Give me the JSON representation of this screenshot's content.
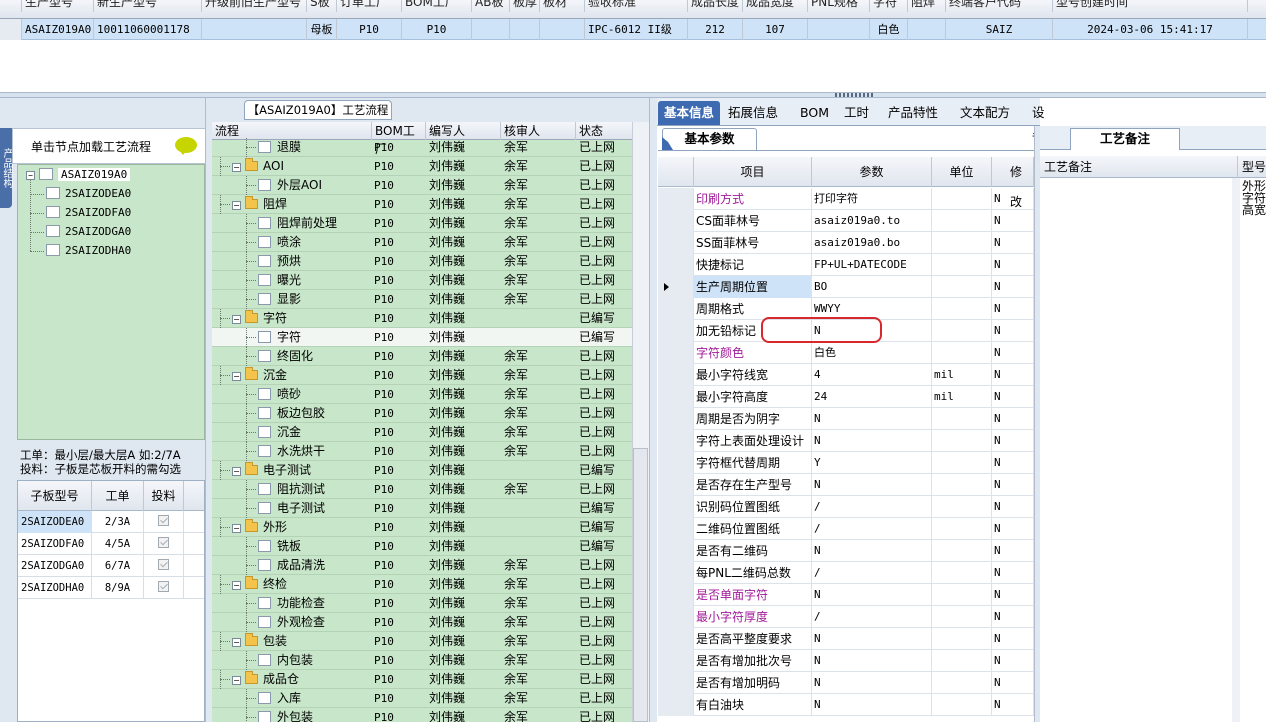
{
  "top_grid": {
    "headers": [
      "生产型号",
      "新生产型号",
      "升级前旧生产型号",
      "S板",
      "订单工厂",
      "BOM工厂",
      "AB板",
      "板厚",
      "板材",
      "验收标准",
      "成品长度",
      "成品宽度",
      "PNL规格",
      "字符",
      "阻焊",
      "终端客户代码",
      "型号创建时间"
    ],
    "row": [
      "ASAIZ019A0",
      "10011060001178",
      "",
      "母板",
      "P10",
      "P10",
      "",
      "",
      "",
      "IPC-6012 II级",
      "212",
      "107",
      "",
      "白色",
      "",
      "SAIZ",
      "2024-03-06 15:41:17"
    ]
  },
  "left_panel": {
    "vertical_tab": "产品结构",
    "hint": "单击节点加载工艺流程",
    "tree_root": "ASAIZ019A0",
    "tree_children": [
      "2SAIZODEA0",
      "2SAIZODFA0",
      "2SAIZODGA0",
      "2SAIZODHA0"
    ],
    "info_line1": "工单：最小层/最大层A 如:2/7A",
    "info_line2": "投料：子板是芯板开料的需勾选",
    "sub_headers": [
      "子板型号",
      "工单",
      "投料"
    ],
    "sub_rows": [
      {
        "model": "2SAIZODEA0",
        "order": "2/3A"
      },
      {
        "model": "2SAIZODFA0",
        "order": "4/5A"
      },
      {
        "model": "2SAIZODGA0",
        "order": "6/7A"
      },
      {
        "model": "2SAIZODHA0",
        "order": "8/9A"
      }
    ]
  },
  "process": {
    "title": "【ASAIZ019A0】工艺流程",
    "headers": [
      "流程",
      "BOM工厂",
      "编写人",
      "核审人",
      "状态"
    ],
    "rows": [
      {
        "name": "退膜",
        "type": "leaf",
        "factory": "P10",
        "writer": "刘伟巍",
        "reviewer": "余军",
        "status": "已上网"
      },
      {
        "name": "AOI",
        "type": "folder",
        "factory": "P10",
        "writer": "刘伟巍",
        "reviewer": "余军",
        "status": "已上网"
      },
      {
        "name": "外层AOI",
        "type": "leaf",
        "factory": "P10",
        "writer": "刘伟巍",
        "reviewer": "余军",
        "status": "已上网"
      },
      {
        "name": "阻焊",
        "type": "folder",
        "factory": "P10",
        "writer": "刘伟巍",
        "reviewer": "余军",
        "status": "已上网"
      },
      {
        "name": "阻焊前处理",
        "type": "leaf",
        "factory": "P10",
        "writer": "刘伟巍",
        "reviewer": "余军",
        "status": "已上网"
      },
      {
        "name": "喷涂",
        "type": "leaf",
        "factory": "P10",
        "writer": "刘伟巍",
        "reviewer": "余军",
        "status": "已上网"
      },
      {
        "name": "预烘",
        "type": "leaf",
        "factory": "P10",
        "writer": "刘伟巍",
        "reviewer": "余军",
        "status": "已上网"
      },
      {
        "name": "曝光",
        "type": "leaf",
        "factory": "P10",
        "writer": "刘伟巍",
        "reviewer": "余军",
        "status": "已上网"
      },
      {
        "name": "显影",
        "type": "leaf",
        "factory": "P10",
        "writer": "刘伟巍",
        "reviewer": "余军",
        "status": "已上网"
      },
      {
        "name": "字符",
        "type": "folder",
        "factory": "P10",
        "writer": "刘伟巍",
        "reviewer": "",
        "status": "已编写"
      },
      {
        "name": "字符",
        "type": "leaf",
        "factory": "P10",
        "writer": "刘伟巍",
        "reviewer": "",
        "status": "已编写"
      },
      {
        "name": "终固化",
        "type": "leaf",
        "factory": "P10",
        "writer": "刘伟巍",
        "reviewer": "余军",
        "status": "已上网"
      },
      {
        "name": "沉金",
        "type": "folder",
        "factory": "P10",
        "writer": "刘伟巍",
        "reviewer": "余军",
        "status": "已上网"
      },
      {
        "name": "喷砂",
        "type": "leaf",
        "factory": "P10",
        "writer": "刘伟巍",
        "reviewer": "余军",
        "status": "已上网"
      },
      {
        "name": "板边包胶",
        "type": "leaf",
        "factory": "P10",
        "writer": "刘伟巍",
        "reviewer": "余军",
        "status": "已上网"
      },
      {
        "name": "沉金",
        "type": "leaf",
        "factory": "P10",
        "writer": "刘伟巍",
        "reviewer": "余军",
        "status": "已上网"
      },
      {
        "name": "水洗烘干",
        "type": "leaf",
        "factory": "P10",
        "writer": "刘伟巍",
        "reviewer": "余军",
        "status": "已上网"
      },
      {
        "name": "电子测试",
        "type": "folder",
        "factory": "P10",
        "writer": "刘伟巍",
        "reviewer": "",
        "status": "已编写"
      },
      {
        "name": "阻抗测试",
        "type": "leaf",
        "factory": "P10",
        "writer": "刘伟巍",
        "reviewer": "余军",
        "status": "已上网"
      },
      {
        "name": "电子测试",
        "type": "leaf",
        "factory": "P10",
        "writer": "刘伟巍",
        "reviewer": "",
        "status": "已编写"
      },
      {
        "name": "外形",
        "type": "folder",
        "factory": "P10",
        "writer": "刘伟巍",
        "reviewer": "",
        "status": "已编写"
      },
      {
        "name": "铣板",
        "type": "leaf",
        "factory": "P10",
        "writer": "刘伟巍",
        "reviewer": "",
        "status": "已编写"
      },
      {
        "name": "成品清洗",
        "type": "leaf",
        "factory": "P10",
        "writer": "刘伟巍",
        "reviewer": "余军",
        "status": "已上网"
      },
      {
        "name": "终检",
        "type": "folder",
        "factory": "P10",
        "writer": "刘伟巍",
        "reviewer": "余军",
        "status": "已上网"
      },
      {
        "name": "功能检查",
        "type": "leaf",
        "factory": "P10",
        "writer": "刘伟巍",
        "reviewer": "余军",
        "status": "已上网"
      },
      {
        "name": "外观检查",
        "type": "leaf",
        "factory": "P10",
        "writer": "刘伟巍",
        "reviewer": "余军",
        "status": "已上网"
      },
      {
        "name": "包装",
        "type": "folder",
        "factory": "P10",
        "writer": "刘伟巍",
        "reviewer": "余军",
        "status": "已上网"
      },
      {
        "name": "内包装",
        "type": "leaf",
        "factory": "P10",
        "writer": "刘伟巍",
        "reviewer": "余军",
        "status": "已上网"
      },
      {
        "name": "成品仓",
        "type": "folder",
        "factory": "P10",
        "writer": "刘伟巍",
        "reviewer": "余军",
        "status": "已上网"
      },
      {
        "name": "入库",
        "type": "leaf",
        "factory": "P10",
        "writer": "刘伟巍",
        "reviewer": "余军",
        "status": "已上网"
      },
      {
        "name": "外包装",
        "type": "leaf",
        "factory": "P10",
        "writer": "刘伟巍",
        "reviewer": "余军",
        "status": "已上网"
      }
    ]
  },
  "right_tabs": [
    "基本信息",
    "拓展信息",
    "BOM",
    "工时",
    "产品特性",
    "文本配方",
    "设备配方"
  ],
  "basic_params": {
    "subtab": "基本参数",
    "headers": [
      "项目",
      "参数",
      "单位",
      "修改"
    ],
    "rows": [
      {
        "item": "印刷方式",
        "value": "打印字符",
        "unit": "",
        "mod": "N",
        "magenta": true
      },
      {
        "item": "CS面菲林号",
        "value": "asaiz019a0.to",
        "unit": "",
        "mod": "N"
      },
      {
        "item": "SS面菲林号",
        "value": "asaiz019a0.bo",
        "unit": "",
        "mod": "N"
      },
      {
        "item": "快捷标记",
        "value": "FP+UL+DATECODE",
        "unit": "",
        "mod": "N"
      },
      {
        "item": "生产周期位置",
        "value": "BO",
        "unit": "",
        "mod": "N",
        "current": true
      },
      {
        "item": "周期格式",
        "value": "WWYY",
        "unit": "",
        "mod": "N"
      },
      {
        "item": "加无铅标记",
        "value": "N",
        "unit": "",
        "mod": "N"
      },
      {
        "item": "字符颜色",
        "value": "白色",
        "unit": "",
        "mod": "N",
        "magenta": true
      },
      {
        "item": "最小字符线宽",
        "value": "4",
        "unit": "mil",
        "mod": "N"
      },
      {
        "item": "最小字符高度",
        "value": "24",
        "unit": "mil",
        "mod": "N"
      },
      {
        "item": "周期是否为阴字",
        "value": "N",
        "unit": "",
        "mod": "N"
      },
      {
        "item": "字符上表面处理设计",
        "value": "N",
        "unit": "",
        "mod": "N"
      },
      {
        "item": "字符框代替周期",
        "value": "Y",
        "unit": "",
        "mod": "N"
      },
      {
        "item": "是否存在生产型号",
        "value": "N",
        "unit": "",
        "mod": "N"
      },
      {
        "item": "识别码位置图纸",
        "value": "/",
        "unit": "",
        "mod": "N"
      },
      {
        "item": "二维码位置图纸",
        "value": "/",
        "unit": "",
        "mod": "N"
      },
      {
        "item": "是否有二维码",
        "value": "N",
        "unit": "",
        "mod": "N"
      },
      {
        "item": "每PNL二维码总数",
        "value": "/",
        "unit": "",
        "mod": "N"
      },
      {
        "item": "是否单面字符",
        "value": "N",
        "unit": "",
        "mod": "N",
        "magenta": true
      },
      {
        "item": "最小字符厚度",
        "value": "/",
        "unit": "",
        "mod": "N",
        "magenta": true
      },
      {
        "item": "是否高平整度要求",
        "value": "N",
        "unit": "",
        "mod": "N"
      },
      {
        "item": "是否有增加批次号",
        "value": "N",
        "unit": "",
        "mod": "N"
      },
      {
        "item": "是否有增加明码",
        "value": "N",
        "unit": "",
        "mod": "N"
      },
      {
        "item": "有白油块",
        "value": "N",
        "unit": "",
        "mod": "N"
      }
    ]
  },
  "craft_notes": {
    "tab": "工艺备注",
    "headers": [
      "工艺备注",
      "型号"
    ],
    "note_lines": [
      "外形",
      "字符",
      "高宽"
    ]
  },
  "colors": {
    "accent": "#3d6ab0",
    "tree_bg": "#c8e6c9",
    "selection": "#cfe3f8",
    "highlight": "#d9272e"
  }
}
